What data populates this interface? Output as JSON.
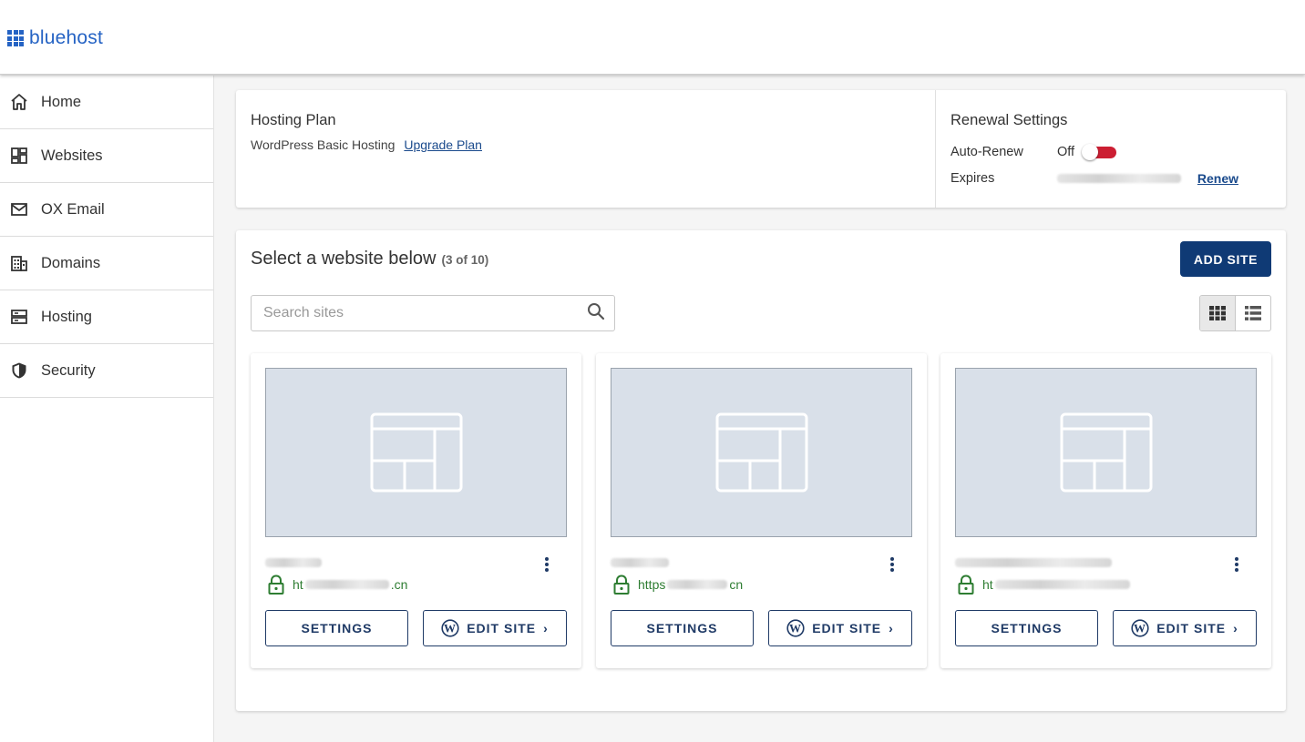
{
  "brand": {
    "name": "bluehost",
    "color": "#2563c4"
  },
  "sidebar": {
    "items": [
      {
        "label": "Home",
        "icon": "home-icon"
      },
      {
        "label": "Websites",
        "icon": "websites-icon"
      },
      {
        "label": "OX Email",
        "icon": "mail-icon"
      },
      {
        "label": "Domains",
        "icon": "domains-icon"
      },
      {
        "label": "Hosting",
        "icon": "server-icon"
      },
      {
        "label": "Security",
        "icon": "shield-icon"
      }
    ]
  },
  "hosting_plan": {
    "title": "Hosting Plan",
    "plan_name": "WordPress Basic Hosting",
    "upgrade_label": "Upgrade Plan"
  },
  "renewal": {
    "title": "Renewal Settings",
    "auto_renew_label": "Auto-Renew",
    "auto_renew_state": "Off",
    "expires_label": "Expires",
    "renew_label": "Renew",
    "toggle_color": "#cc1e32"
  },
  "sites": {
    "title": "Select a website below",
    "count": "(3 of 10)",
    "add_label": "ADD SITE",
    "search_placeholder": "Search sites",
    "view_mode": "grid",
    "cards": [
      {
        "url_prefix": "ht",
        "url_suffix": ".cn",
        "settings_label": "SETTINGS",
        "edit_label": "EDIT SITE"
      },
      {
        "url_prefix": "https",
        "url_suffix": "cn",
        "settings_label": "SETTINGS",
        "edit_label": "EDIT SITE"
      },
      {
        "url_prefix": "ht",
        "url_suffix": "",
        "settings_label": "SETTINGS",
        "edit_label": "EDIT SITE"
      }
    ]
  },
  "colors": {
    "primary_button": "#0f3a75",
    "link": "#1a4a8c",
    "secure": "#2e7d32"
  }
}
